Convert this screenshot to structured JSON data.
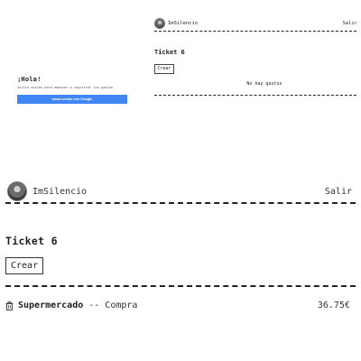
{
  "login": {
    "greeting": "¡Hola!",
    "subtitle": "Inicia sesión para empezar a registrar tus gastos",
    "google_button": "Inicia sesión con Google",
    "google_color": "#4285f4"
  },
  "small_view": {
    "username": "ImSilencio",
    "exit_label": "Salir",
    "ticket_title": "Ticket 6",
    "create_label": "Crear",
    "empty_text": "No hay gastos"
  },
  "large_view": {
    "username": "ImSilencio",
    "exit_label": "Salir",
    "ticket_title": "Ticket 6",
    "create_label": "Crear",
    "expenses": [
      {
        "name": "Supermercado",
        "separator": "--",
        "type": "Compra",
        "amount": "36.75€",
        "icon": "trash-icon"
      }
    ]
  }
}
